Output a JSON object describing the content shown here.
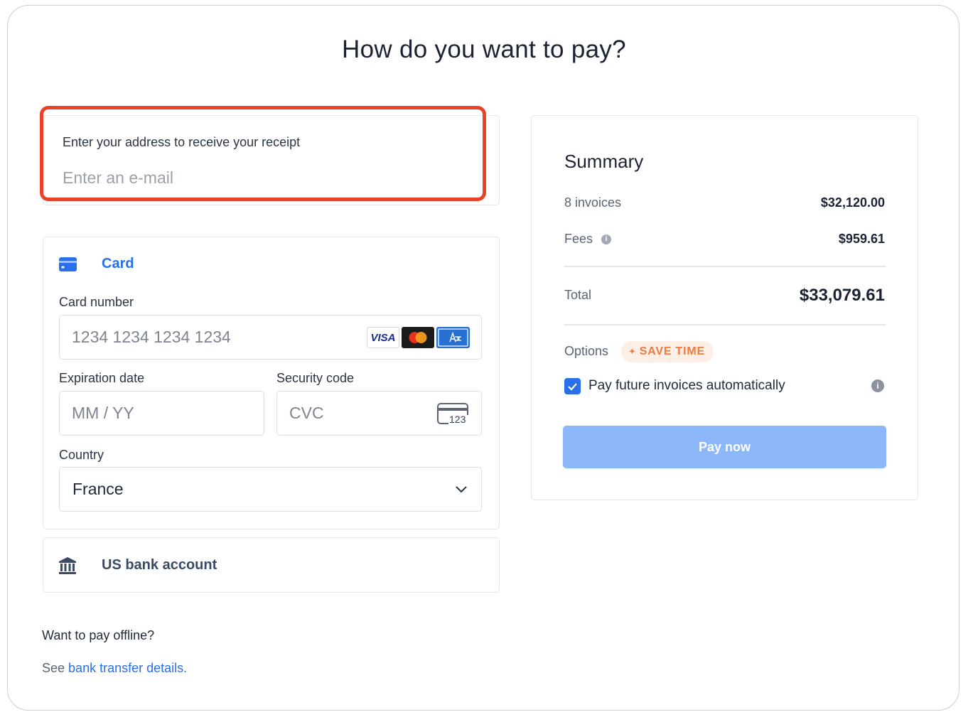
{
  "page": {
    "title": "How do you want to pay?"
  },
  "email": {
    "label": "Enter your address to receive your receipt",
    "placeholder": "Enter an e-mail"
  },
  "card": {
    "title": "Card",
    "card_number_label": "Card number",
    "card_number_placeholder": "1234 1234 1234 1234",
    "brands": [
      "visa-icon",
      "mastercard-icon",
      "amex-icon"
    ],
    "visa_text": "VISA",
    "expiration_label": "Expiration date",
    "expiration_placeholder": "MM / YY",
    "security_label": "Security code",
    "security_placeholder": "CVC",
    "cvc_icon_text": "123",
    "country_label": "Country",
    "country_value": "France"
  },
  "bank": {
    "label": "US bank account"
  },
  "offline": {
    "title": "Want to pay offline?",
    "prefix": "See",
    "link": "bank transfer details",
    "suffix": "."
  },
  "summary": {
    "title": "Summary",
    "rows": [
      {
        "label": "8 invoices",
        "value": "$32,120.00"
      },
      {
        "label": "Fees",
        "value": "$959.61"
      }
    ],
    "total_label": "Total",
    "total_value": "$33,079.61",
    "options_label": "Options",
    "badge": "SAVE TIME",
    "auto_pay_label": "Pay future invoices automatically",
    "auto_pay_checked": true,
    "pay_button": "Pay now"
  },
  "colors": {
    "accent": "#2970e8",
    "highlight": "#e8432a",
    "badge_text": "#f07b3f",
    "pay_button": "#8cb7f8"
  }
}
